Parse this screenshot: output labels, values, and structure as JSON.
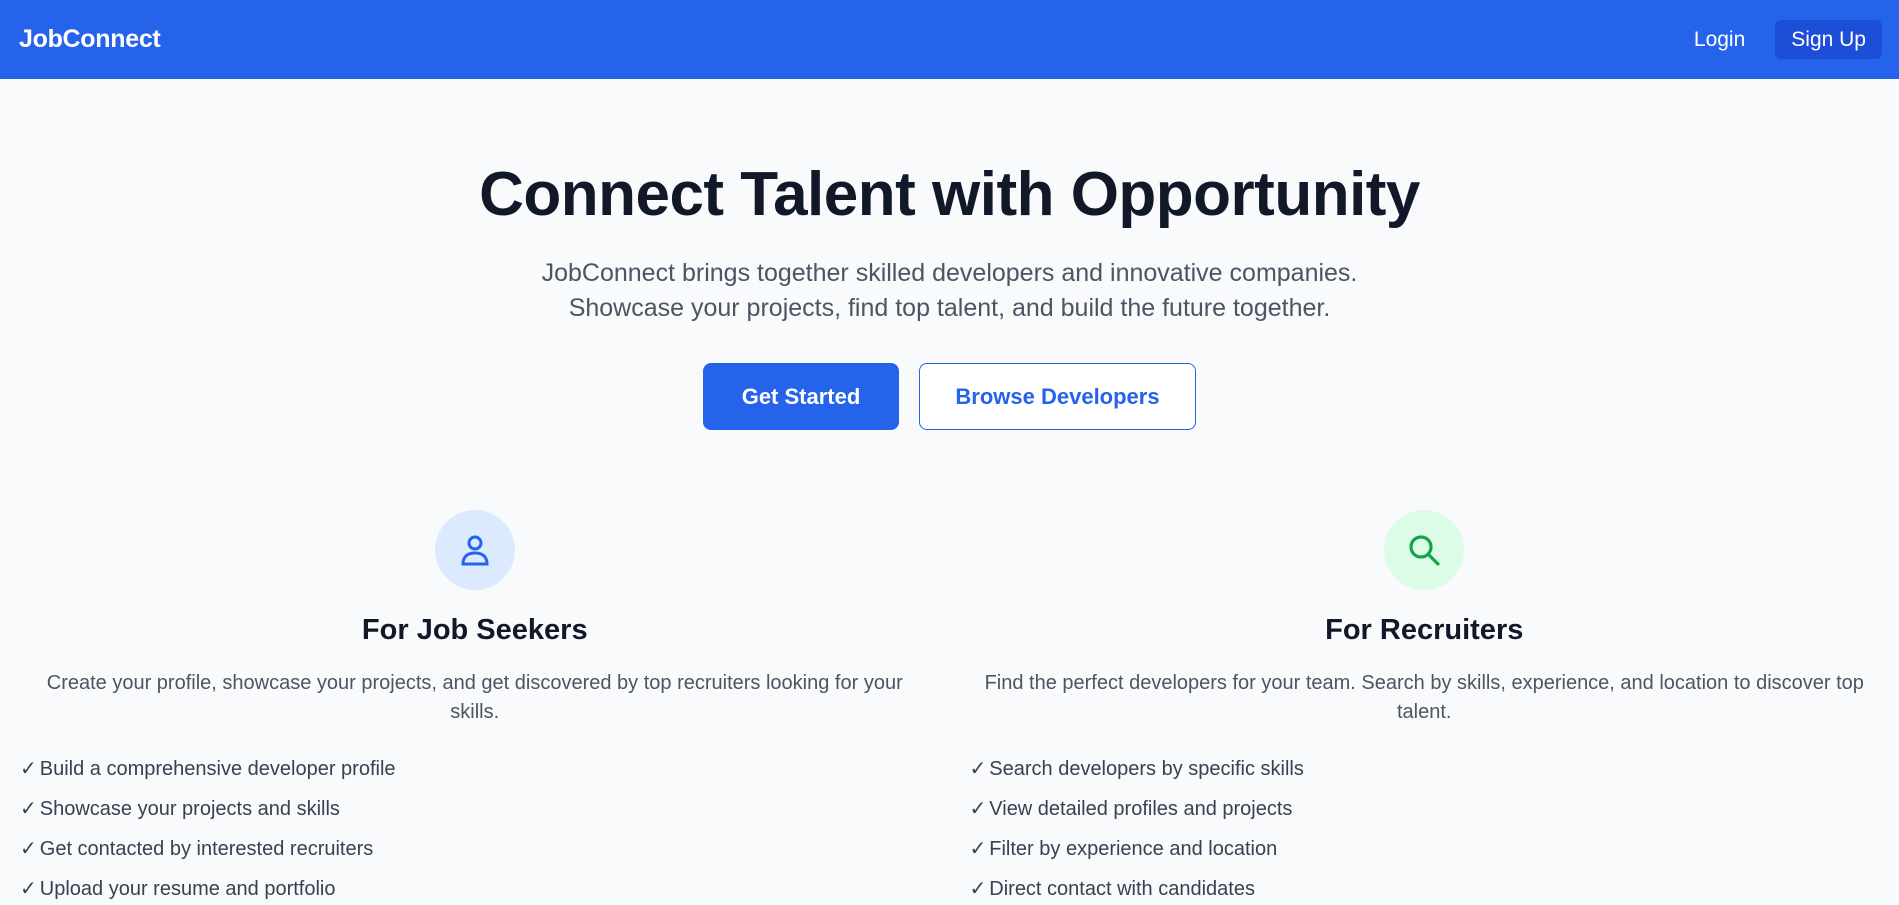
{
  "nav": {
    "brand": "JobConnect",
    "login_label": "Login",
    "signup_label": "Sign Up"
  },
  "hero": {
    "title": "Connect Talent with Opportunity",
    "subtitle_line1": "JobConnect brings together skilled developers and innovative companies.",
    "subtitle_line2": "Showcase your projects, find top talent, and build the future together.",
    "primary_button": "Get Started",
    "secondary_button": "Browse Developers"
  },
  "features": {
    "seekers": {
      "icon": "user-icon",
      "title": "For Job Seekers",
      "description": "Create your profile, showcase your projects, and get discovered by top recruiters looking for your skills.",
      "items": [
        "Build a comprehensive developer profile",
        "Showcase your projects and skills",
        "Get contacted by interested recruiters",
        "Upload your resume and portfolio"
      ]
    },
    "recruiters": {
      "icon": "search-icon",
      "title": "For Recruiters",
      "description": "Find the perfect developers for your team. Search by skills, experience, and location to discover top talent.",
      "items": [
        "Search developers by specific skills",
        "View detailed profiles and projects",
        "Filter by experience and location",
        "Direct contact with candidates"
      ]
    }
  },
  "check_mark": "✓",
  "colors": {
    "primary": "#2563eb",
    "primary_dark": "#1d4ed8",
    "background": "#f8fafc",
    "icon_blue_bg": "#dbeafe",
    "icon_green_bg": "#dcfce7",
    "icon_green": "#16a34a"
  }
}
